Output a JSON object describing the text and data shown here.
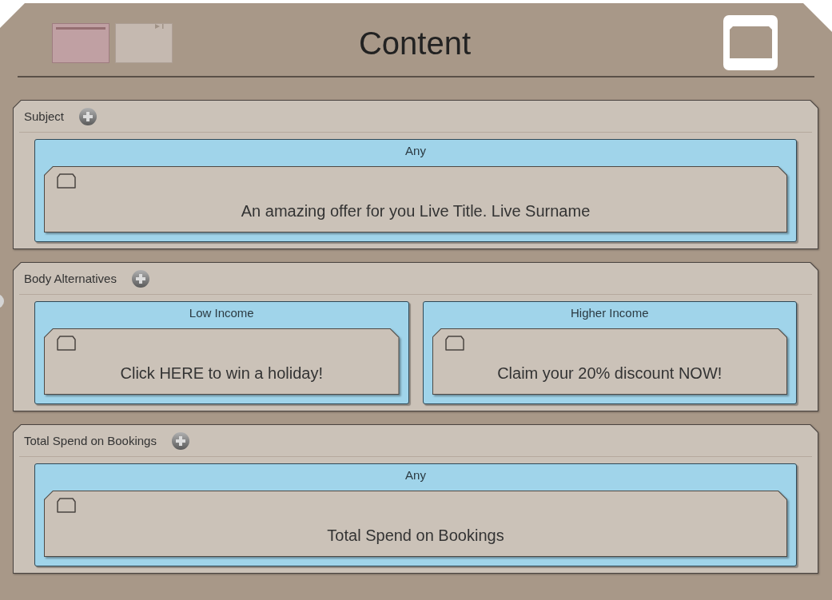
{
  "header": {
    "title": "Content",
    "thumbnails": [
      {
        "kind": "banner",
        "selected": true
      },
      {
        "kind": "skip",
        "selected": false
      }
    ]
  },
  "sections": [
    {
      "title": "Subject",
      "variants": [
        {
          "label": "Any",
          "content": "An amazing offer for you Live Title. Live Surname"
        }
      ]
    },
    {
      "title": "Body Alternatives",
      "variants": [
        {
          "label": "Low Income",
          "content": "Click HERE to win a holiday!"
        },
        {
          "label": "Higher Income",
          "content": "Claim your 20% discount NOW!"
        }
      ]
    },
    {
      "title": "Total Spend on Bookings",
      "variants": [
        {
          "label": "Any",
          "content": "Total Spend on Bookings"
        }
      ]
    }
  ]
}
